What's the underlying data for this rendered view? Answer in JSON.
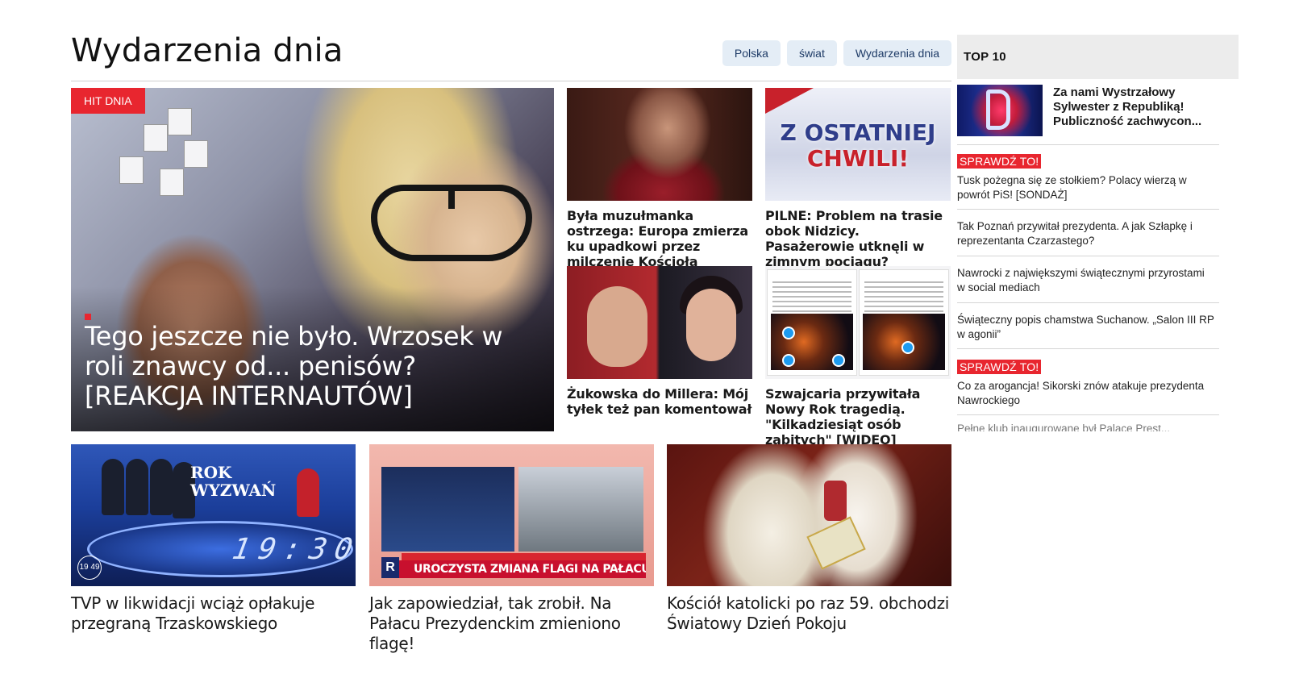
{
  "section": {
    "title": "Wydarzenia dnia",
    "tabs": [
      "Polska",
      "świat",
      "Wydarzenia dnia"
    ]
  },
  "hero": {
    "badge": "HIT DNIA",
    "title": "Tego jeszcze nie było. Wrzosek w roli znawcy od... penisów? [REAKCJA INTERNAUTÓW]"
  },
  "cards": [
    {
      "title": "Była muzułmanka ostrzega: Europa zmierza ku upadkowi przez milczenie Kościoła"
    },
    {
      "title": "PILNE: Problem na trasie obok Nidzicy. Pasażerowie utknęli w zimnym pociągu?",
      "thumb_text": [
        "Z OSTATNIEJ",
        "CHWILI!"
      ]
    },
    {
      "title": "Żukowska do Millera: Mój tyłek też pan komentował"
    },
    {
      "title": "Szwajcaria przywitała Nowy Rok tragedią. \"Kilkadziesiąt osób zabitych\" [WIDEO]"
    }
  ],
  "bottom_cards": [
    {
      "title": "TVP w likwidacji wciąż opłakuje przegraną Trzaskowskiego",
      "thumb_text": [
        "ROK",
        "WYZWAŃ"
      ],
      "clock_text": "19:30",
      "time_text": "19 49"
    },
    {
      "title": "Jak zapowiedział, tak zrobił. Na Pałacu Prezydenckim zmieniono flagę!",
      "bar_text": "UROCZYSTA ZMIANA FLAGI NA PAŁACU PREZYDENCKIM",
      "logo_text": "R"
    },
    {
      "title": "Kościół katolicki po raz 59. obchodzi Światowy Dzień Pokoju"
    }
  ],
  "sidebar": {
    "header": "TOP 10",
    "top_item": {
      "title": "Za nami Wystrzałowy Sylwester z Republiką! Publiczność zachwycon..."
    },
    "badge": "SPRAWDŹ TO!",
    "links": [
      "Tusk pożegna się ze stołkiem? Polacy wierzą w powrót PiS! [SONDAŻ]",
      "Tak Poznań przywitał prezydenta. A jak Szłapkę i reprezentanta Czarzastego?",
      "Nawrocki z największymi świątecznymi przyrostami w social mediach",
      "Świąteczny popis chamstwa Suchanow. „Salon III RP w agonii”",
      "Co za arogancja! Sikorski znów atakuje prezydenta Nawrockiego"
    ],
    "cut_off_text": "Pełne klub inaugurowane był Palace Prest..."
  },
  "colors": {
    "accent_red": "#e8262f",
    "tab_bg": "#e4edf6",
    "tab_text": "#1d3a66"
  }
}
